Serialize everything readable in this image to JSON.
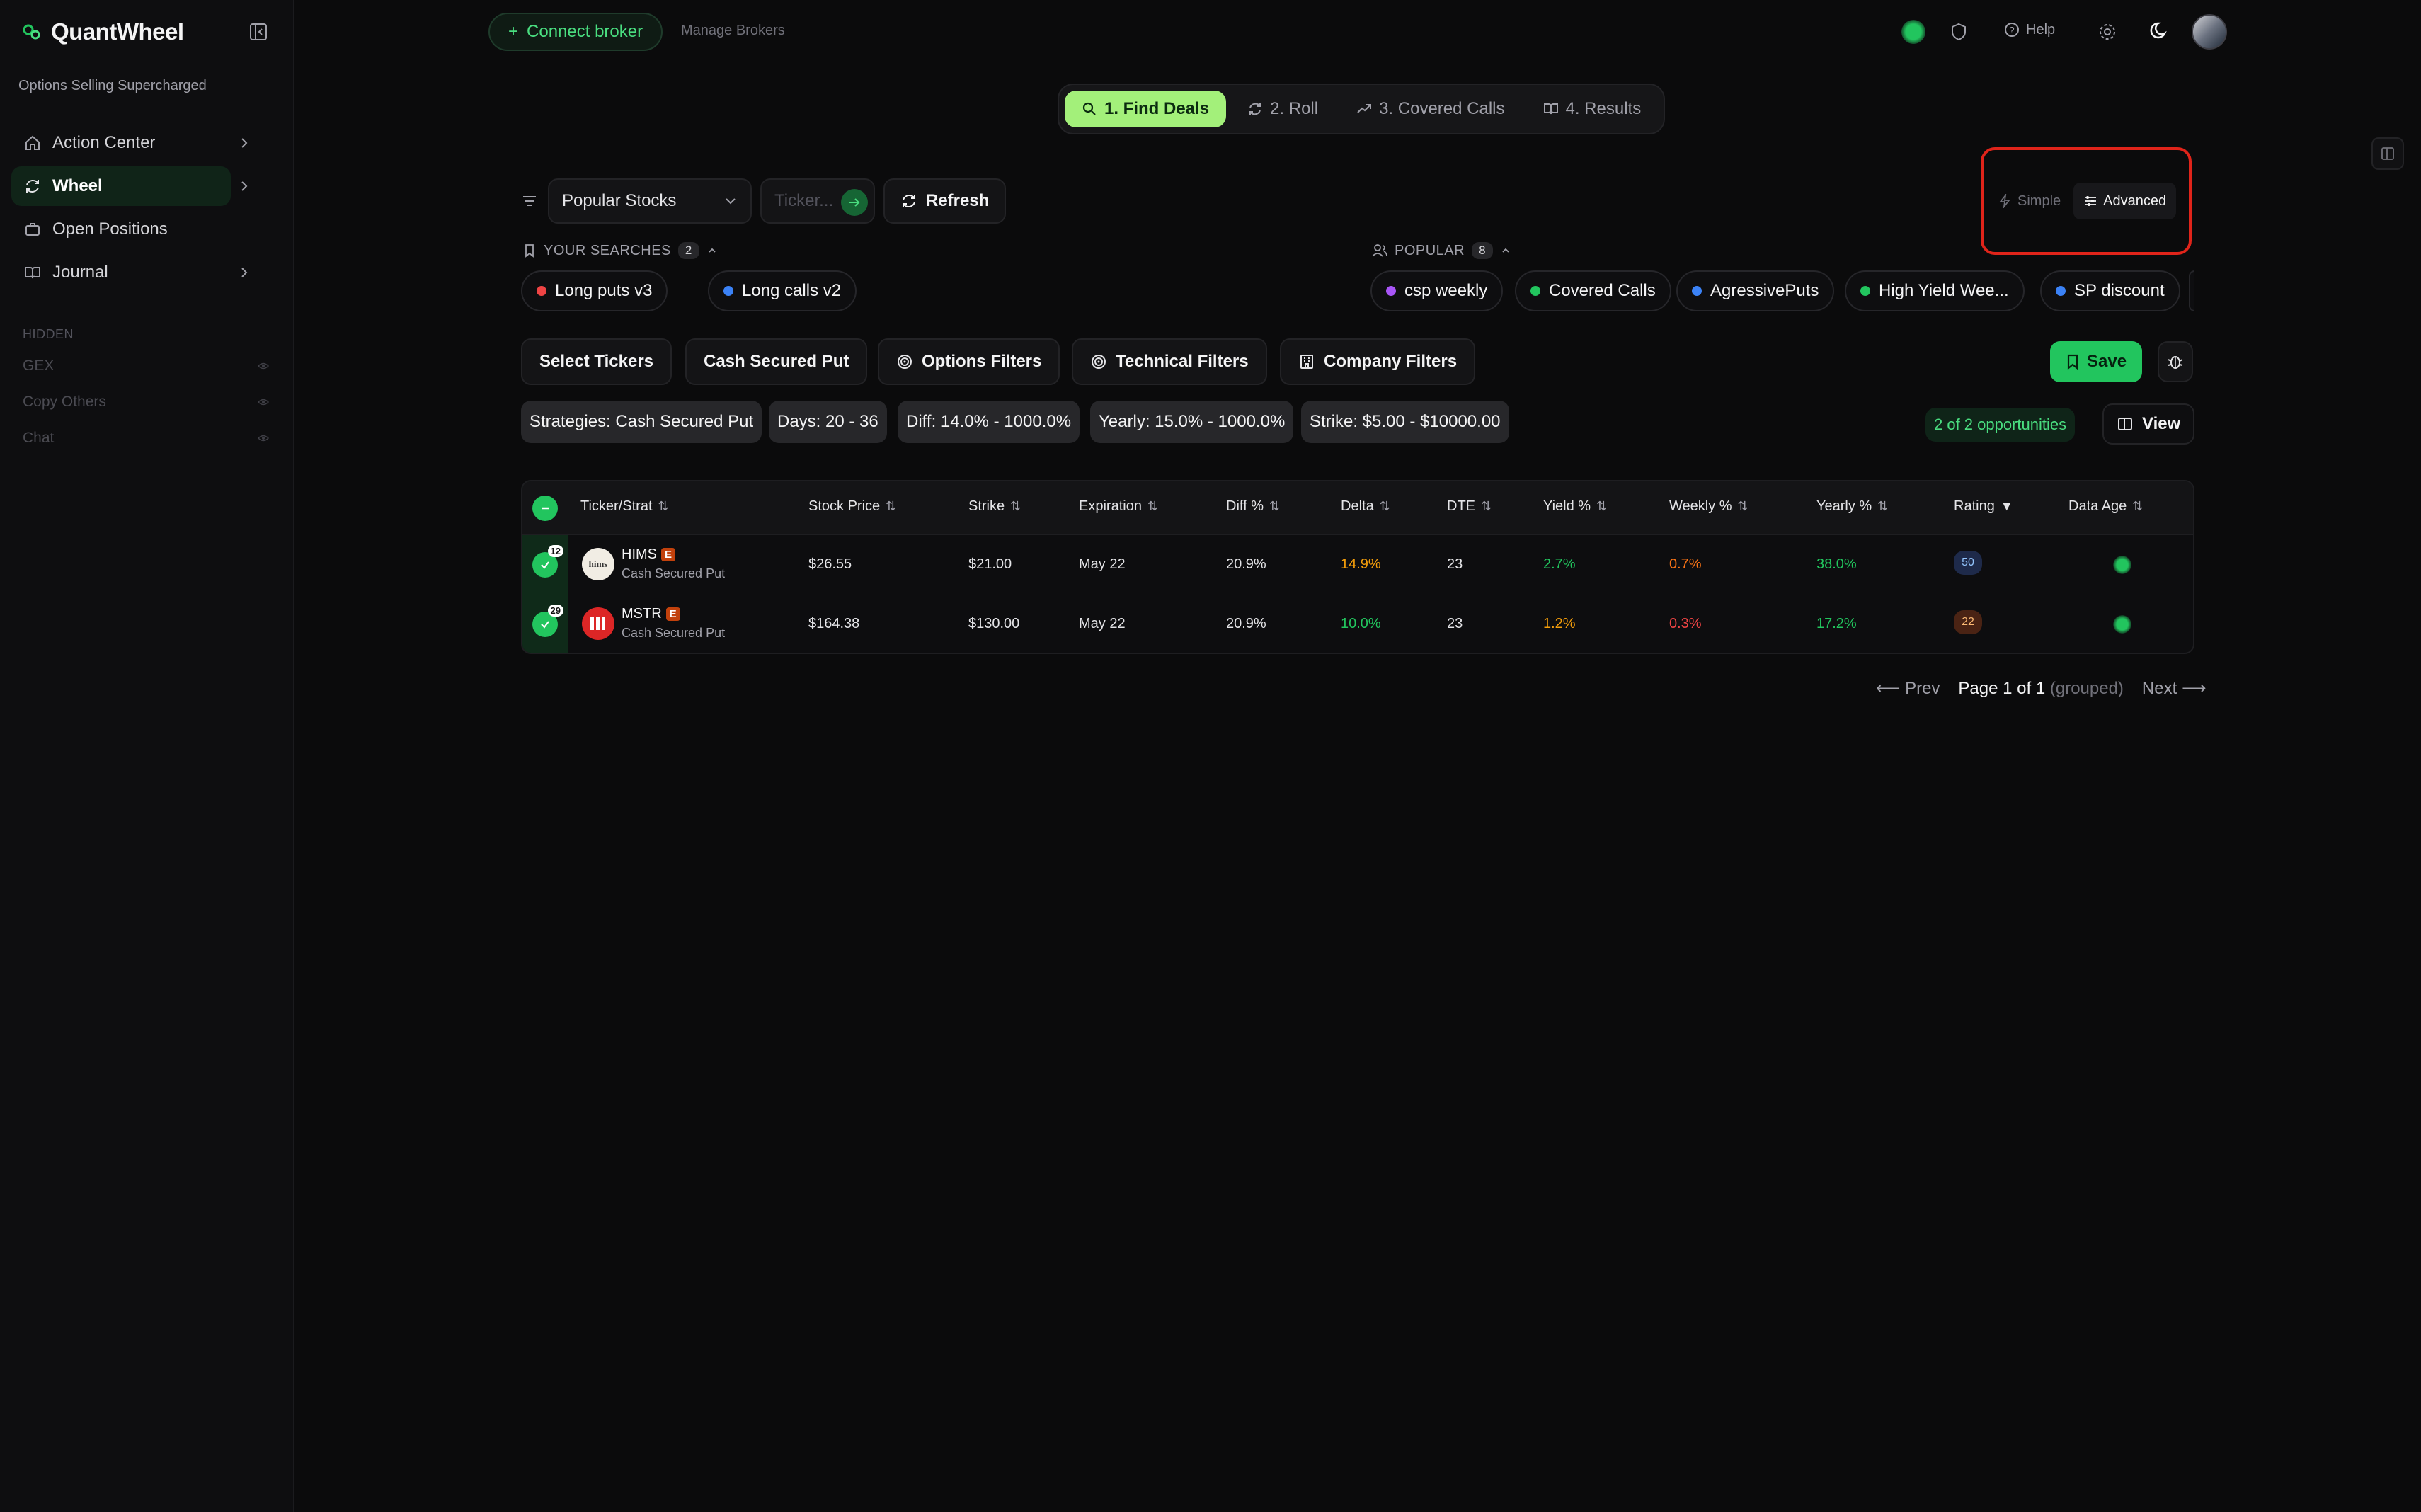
{
  "app": {
    "name": "QuantWheel",
    "tagline": "Options Selling Supercharged"
  },
  "sidebar": {
    "items": [
      {
        "label": "Action Center",
        "icon": "home-icon"
      },
      {
        "label": "Wheel",
        "icon": "refresh-icon",
        "active": true
      },
      {
        "label": "Open Positions",
        "icon": "briefcase-icon"
      },
      {
        "label": "Journal",
        "icon": "book-icon"
      }
    ],
    "hidden_label": "HIDDEN",
    "hidden_items": [
      {
        "label": "GEX"
      },
      {
        "label": "Copy Others"
      },
      {
        "label": "Chat"
      }
    ]
  },
  "topbar": {
    "connect_label": "Connect broker",
    "manage_label": "Manage Brokers",
    "help_label": "Help"
  },
  "steps": [
    {
      "label": "1. Find Deals",
      "icon": "search-icon",
      "active": true
    },
    {
      "label": "2. Roll",
      "icon": "refresh-icon"
    },
    {
      "label": "3. Covered Calls",
      "icon": "trend-up-icon"
    },
    {
      "label": "4. Results",
      "icon": "book-icon"
    }
  ],
  "filters": {
    "universe": "Popular Stocks",
    "ticker_placeholder": "Ticker...",
    "refresh_label": "Refresh",
    "mode_simple": "Simple",
    "mode_advanced": "Advanced"
  },
  "your_searches": {
    "label": "YOUR SEARCHES",
    "count": "2",
    "items": [
      {
        "label": "Long puts v3",
        "color": "#ef4444"
      },
      {
        "label": "Long calls v2",
        "color": "#3b82f6"
      }
    ]
  },
  "popular": {
    "label": "POPULAR",
    "count": "8",
    "items": [
      {
        "label": "csp weekly",
        "color": "#a855f7"
      },
      {
        "label": "Covered Calls",
        "color": "#22c55e"
      },
      {
        "label": "AgressivePuts",
        "color": "#3b82f6"
      },
      {
        "label": "High Yield Wee...",
        "color": "#22c55e"
      },
      {
        "label": "SP discount",
        "color": "#3b82f6"
      }
    ]
  },
  "filter_buttons": {
    "select_tickers": "Select Tickers",
    "strategy": "Cash Secured Put",
    "options": "Options Filters",
    "technical": "Technical Filters",
    "company": "Company Filters",
    "save": "Save"
  },
  "active_filters": [
    "Strategies: Cash Secured Put",
    "Days: 20 - 36",
    "Diff: 14.0% - 1000.0%",
    "Yearly: 15.0% - 1000.0%",
    "Strike: $5.00 - $10000.00"
  ],
  "results": {
    "count_label": "2 of 2 opportunities",
    "view_label": "View"
  },
  "table": {
    "headers": {
      "ticker": "Ticker/Strat",
      "stock_price": "Stock Price",
      "strike": "Strike",
      "expiration": "Expiration",
      "diff": "Diff %",
      "delta": "Delta",
      "dte": "DTE",
      "yield": "Yield %",
      "weekly": "Weekly %",
      "yearly": "Yearly %",
      "rating": "Rating",
      "data_age": "Data Age"
    },
    "rows": [
      {
        "count": "12",
        "ticker": "HIMS",
        "earnings": "E",
        "strategy": "Cash Secured Put",
        "logo_text": "hims",
        "stock_price": "$26.55",
        "strike": "$21.00",
        "expiration": "May 22",
        "diff": "20.9%",
        "delta": "14.9%",
        "dte": "23",
        "yield": "2.7%",
        "weekly": "0.7%",
        "yearly": "38.0%",
        "rating": "50"
      },
      {
        "count": "29",
        "ticker": "MSTR",
        "earnings": "E",
        "strategy": "Cash Secured Put",
        "logo_text": "",
        "stock_price": "$164.38",
        "strike": "$130.00",
        "expiration": "May 22",
        "diff": "20.9%",
        "delta": "10.0%",
        "dte": "23",
        "yield": "1.2%",
        "weekly": "0.3%",
        "yearly": "17.2%",
        "rating": "22"
      }
    ]
  },
  "pagination": {
    "prev": "⟵ Prev",
    "page": "Page 1 of 1",
    "grouped": "(grouped)",
    "next": "Next ⟶"
  },
  "colors": {
    "accent": "#22c55e",
    "step_active": "#a3f07a",
    "warning": "#f59e0b",
    "danger": "#ef4444",
    "highlight_box": "#e0241a"
  }
}
